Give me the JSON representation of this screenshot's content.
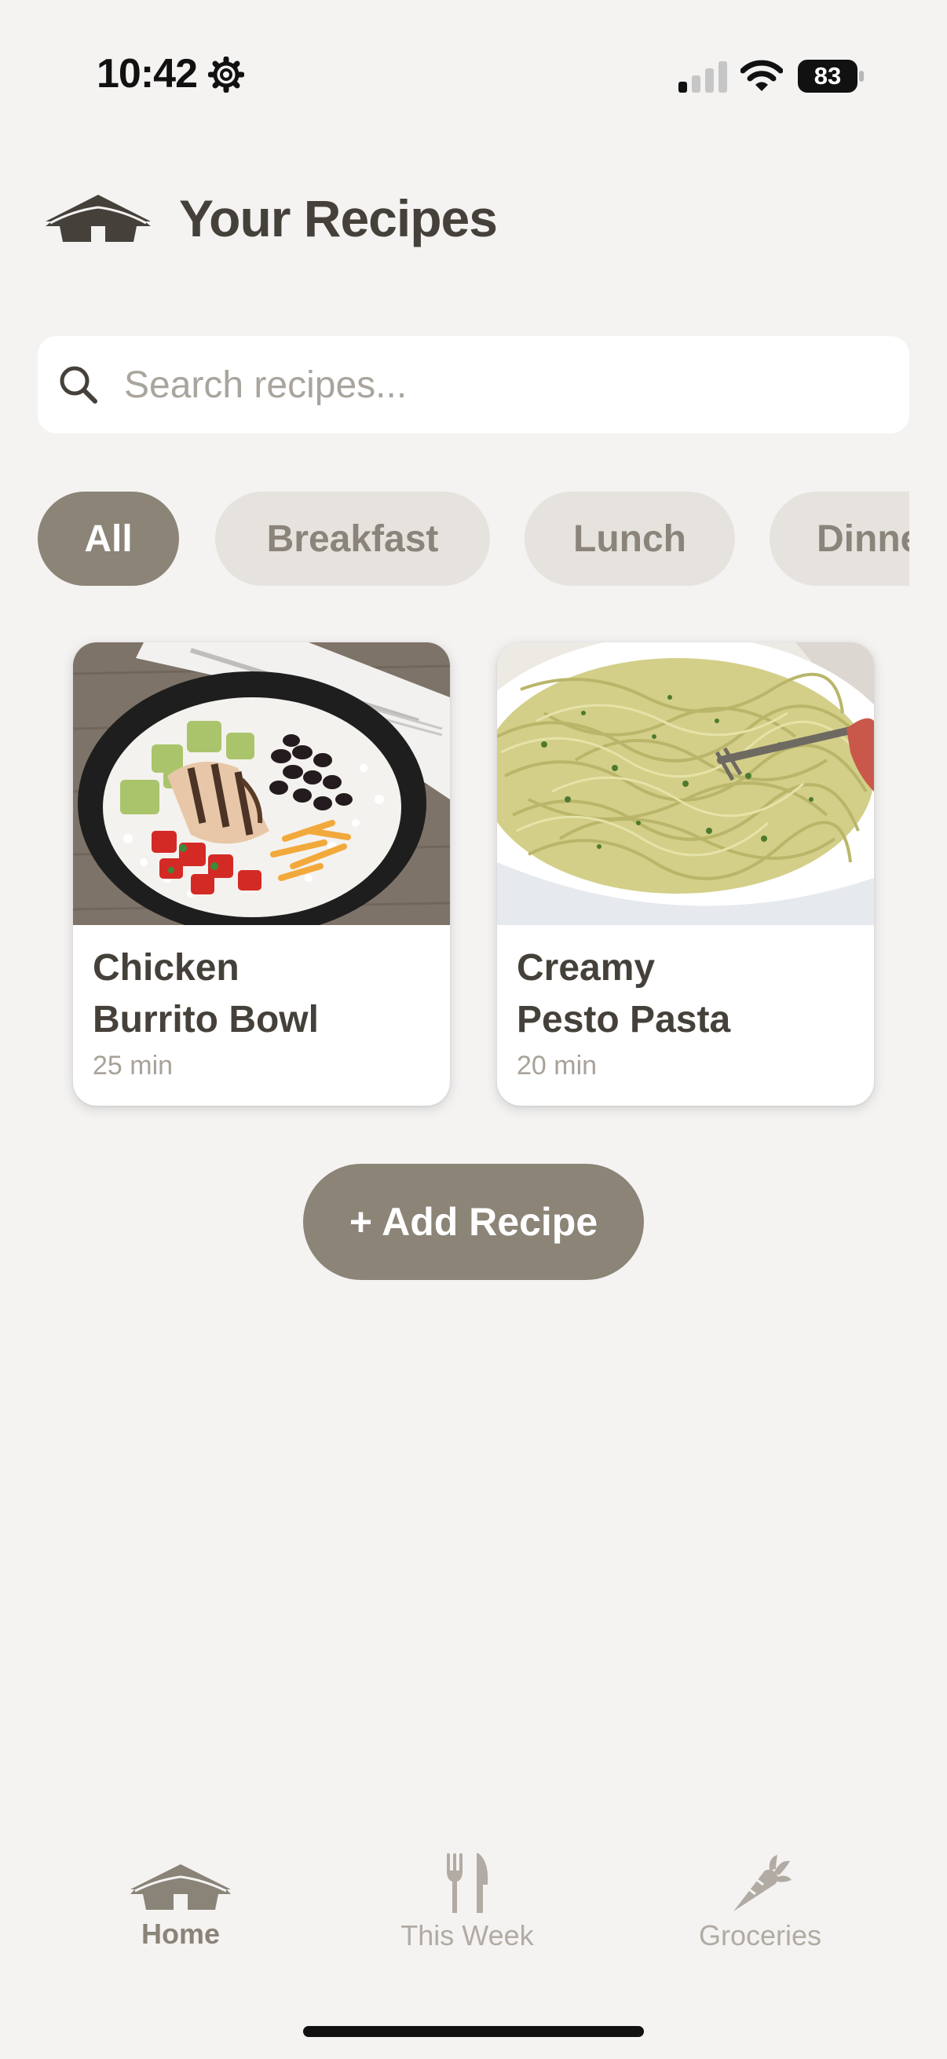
{
  "status_bar": {
    "time": "10:42",
    "battery": "83",
    "icons": [
      "gear-icon",
      "signal-icon",
      "wifi-icon",
      "battery-icon"
    ]
  },
  "header": {
    "logo_icon": "house-icon",
    "title": "Your Recipes"
  },
  "search": {
    "placeholder": "Search recipes...",
    "value": ""
  },
  "categories": {
    "selected": "All",
    "items": [
      "All",
      "Breakfast",
      "Lunch",
      "Dinner"
    ]
  },
  "recipes": [
    {
      "title_line1": "Chicken",
      "title_line2": "Burrito Bowl",
      "time": "25 min"
    },
    {
      "title_line1": "Creamy",
      "title_line2": "Pesto Pasta",
      "time": "20 min"
    }
  ],
  "add_button": {
    "label": "+ Add Recipe"
  },
  "tab_bar": {
    "active": "Home",
    "items": [
      {
        "label": "Home",
        "icon": "house-icon"
      },
      {
        "label": "This Week",
        "icon": "fork-knife-icon"
      },
      {
        "label": "Groceries",
        "icon": "carrot-icon"
      }
    ]
  },
  "colors": {
    "background": "#F4F3F2",
    "accent": "#8B8477",
    "text_primary": "#45413A",
    "text_muted": "#A9A49C",
    "chip_inactive": "#E6E3DE"
  }
}
